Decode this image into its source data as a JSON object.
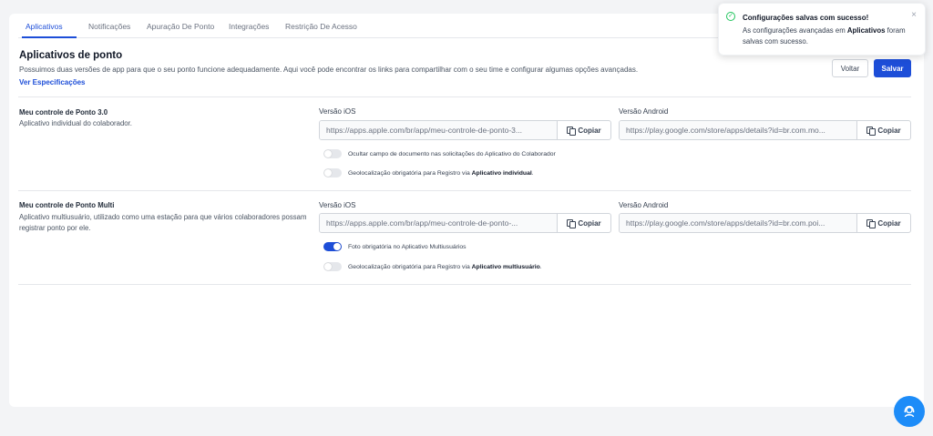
{
  "tabs": [
    {
      "label": "Aplicativos",
      "active": true
    },
    {
      "label": "Notificações",
      "active": false
    },
    {
      "label": "Apuração De Ponto",
      "active": false
    },
    {
      "label": "Integrações",
      "active": false
    },
    {
      "label": "Restrição De Acesso",
      "active": false
    }
  ],
  "section": {
    "title": "Aplicativos de ponto",
    "description": "Possuimos duas versões de app para que o seu ponto funcione adequadamente. Aqui você pode encontrar os links para compartilhar com o seu time e configurar algumas opções avançadas.",
    "link": "Ver Especificações"
  },
  "actions": {
    "back": "Voltar",
    "save": "Salvar"
  },
  "apps": [
    {
      "name": "Meu controle de Ponto 3.0",
      "description": "Aplicativo individual do colaborador.",
      "ios_label": "Versão iOS",
      "ios_url": "https://apps.apple.com/br/app/meu-controle-de-ponto-3...",
      "android_label": "Versão Android",
      "android_url": "https://play.google.com/store/apps/details?id=br.com.mo...",
      "copy_label": "Copiar",
      "toggles": [
        {
          "on": false,
          "text": "Ocultar campo de documento nas solicitações do Aplicativo do Colaborador",
          "bold": "",
          "suffix": ""
        },
        {
          "on": false,
          "text": "Geolocalização obrigatória para Registro via ",
          "bold": "Aplicativo individual",
          "suffix": "."
        }
      ]
    },
    {
      "name": "Meu controle de Ponto Multi",
      "description": "Aplicativo multiusuário, utilizado como uma estação para que vários colaboradores possam registrar ponto por ele.",
      "ios_label": "Versão iOS",
      "ios_url": "https://apps.apple.com/br/app/meu-controle-de-ponto-...",
      "android_label": "Versão Android",
      "android_url": "https://play.google.com/store/apps/details?id=br.com.poi...",
      "copy_label": "Copiar",
      "toggles": [
        {
          "on": true,
          "text": "Foto obrigatória no Aplicativo Multiusuários",
          "bold": "",
          "suffix": ""
        },
        {
          "on": false,
          "text": "Geolocalização obrigatória para Registro via ",
          "bold": "Aplicativo multiusuário",
          "suffix": "."
        }
      ]
    }
  ],
  "toast": {
    "title": "Configurações salvas com sucesso!",
    "message_prefix": "As configurações avançadas em ",
    "message_bold": "Aplicativos",
    "message_suffix": " foram salvas com sucesso.",
    "close": "×"
  },
  "icons": {
    "copy": "copy-icon",
    "success": "check-circle-icon",
    "help": "support-agent-icon"
  },
  "colors": {
    "accent": "#1d4ed8",
    "success": "#22c55e",
    "fab": "#1d8cf8"
  }
}
